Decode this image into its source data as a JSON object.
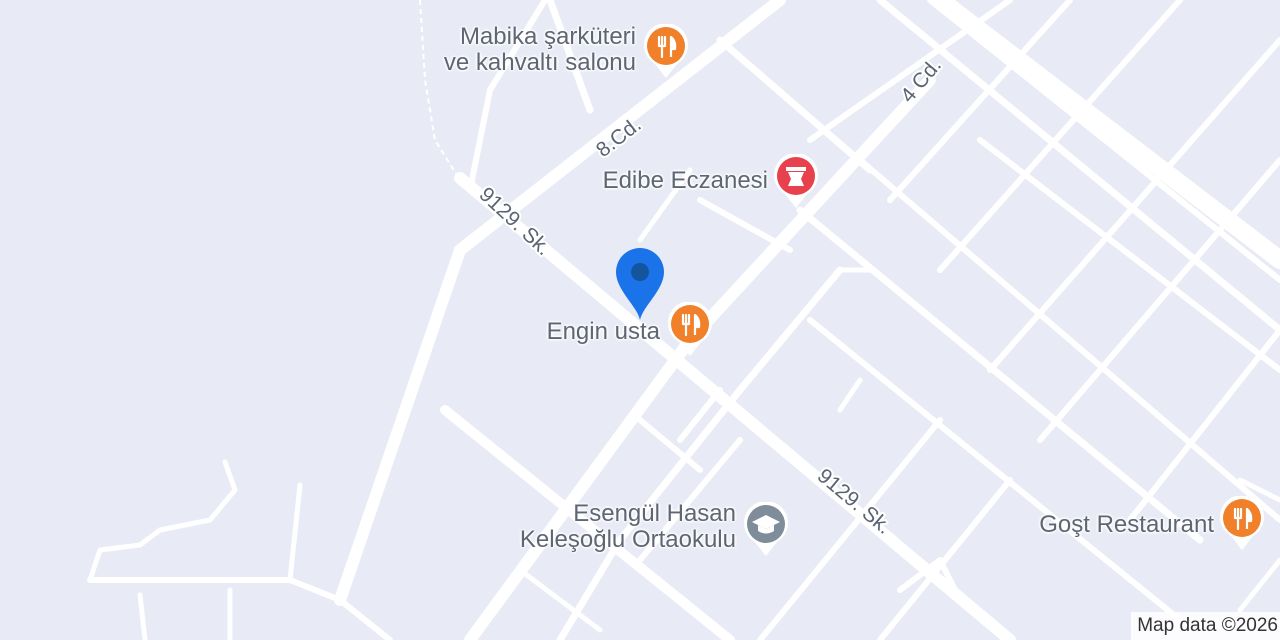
{
  "map": {
    "streets": {
      "eight_cd": "8.Cd.",
      "four_cd": "4 Cd.",
      "sk_9129_upper": "9129. Sk.",
      "sk_9129_lower": "9129. Sk."
    },
    "places": {
      "mabika": {
        "line1": "Mabika şarküteri",
        "line2": "ve kahvaltı salonu",
        "category": "restaurant",
        "icon": "fork-knife-icon",
        "color": "#f0802a"
      },
      "edibe": {
        "line1": "Edibe Eczanesi",
        "category": "pharmacy",
        "icon": "mortar-pestle-icon",
        "color": "#e8414e"
      },
      "engin": {
        "line1": "Engin usta",
        "category": "restaurant",
        "icon": "fork-knife-icon",
        "color": "#f0802a"
      },
      "esengul": {
        "line1": "Esengül Hasan",
        "line2": "Keleşoğlu Ortaokulu",
        "category": "school",
        "icon": "graduation-cap-icon",
        "color": "#7f8c99"
      },
      "gost": {
        "line1": "Goşt Restaurant",
        "category": "restaurant",
        "icon": "fork-knife-icon",
        "color": "#f0802a"
      }
    },
    "location_pin": {
      "icon": "location-pin-icon",
      "color": "#1a73e8"
    },
    "attribution": "Map data ©2026"
  }
}
